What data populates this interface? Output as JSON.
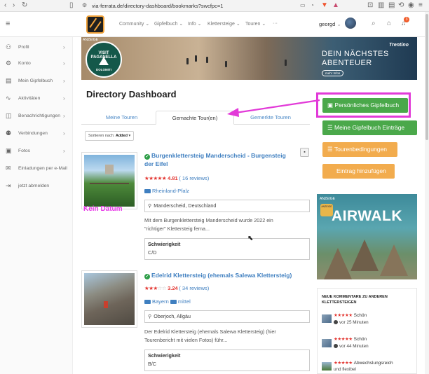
{
  "browser": {
    "url": "via-ferrata.de/directory-dashboard/bookmarks?swcfpc=1"
  },
  "header": {
    "nav": [
      "Community",
      "Gipfelbuch",
      "Info",
      "Klettersteige",
      "Touren",
      "···"
    ],
    "username": "georgd",
    "notification_count": "3"
  },
  "sidebar": {
    "items": [
      {
        "label": "Profil",
        "icon": "user-icon"
      },
      {
        "label": "Konto",
        "icon": "gear-icon"
      },
      {
        "label": "Mein Gipfelbuch",
        "icon": "list-icon"
      },
      {
        "label": "Aktivitäten",
        "icon": "activity-icon"
      },
      {
        "label": "Benachrichtigungen",
        "icon": "bell-icon"
      },
      {
        "label": "Verbindungen",
        "icon": "users-icon"
      },
      {
        "label": "Fotos",
        "icon": "image-icon"
      },
      {
        "label": "Einladungen per e-Mail",
        "icon": "mail-icon"
      },
      {
        "label": "jetzt abmelden",
        "icon": "logout-icon"
      }
    ]
  },
  "banner": {
    "ad_label": "ANZEIGE",
    "badge_line1": "VISIT PAGANELLA",
    "badge_line2": "DOLOMITI",
    "headline1": "DEIN NÄCHSTES",
    "headline2": "ABENTEUER",
    "more": "mehr Infos",
    "brand": "Trentino"
  },
  "page": {
    "title": "Directory Dashboard",
    "tabs": [
      "Meine Touren",
      "Gemachte Tour(en)",
      "Gemerkte Touren"
    ],
    "sort_prefix": "Sortieren nach:",
    "sort_value": "Added",
    "annotation": "Kein Datum"
  },
  "tours": [
    {
      "title_l1": "Burgenklettersteig Manderscheid - Burgensteig",
      "title_l2": "der Eifel",
      "stars": 5,
      "rating": "4.81",
      "reviews": "( 16 reviews)",
      "regions": [
        "Rheinland-Pfalz"
      ],
      "location": "Manderscheid, Deutschland",
      "desc_l1": "Mit dem Burgenklettersteig Manderscheid wurde 2022 ein",
      "desc_l2": "\"richtiger\" Klettersteig ferna...",
      "difficulty_label": "Schwierigkeit",
      "difficulty": "C/D"
    },
    {
      "title_l1": "Edelrid Klettersteig (ehemals Salewa Klettersteig)",
      "stars": 3,
      "rating": "3.24",
      "reviews": "( 34 reviews)",
      "regions": [
        "Bayern",
        "mittel"
      ],
      "location": "Oberjoch, Allgäu",
      "desc_l1": "Der Edelrid Klettersteig (ehemals Salewa Klettersteig) (hier",
      "desc_l2": "Tourenbericht mit vielen Fotos) führ...",
      "difficulty_label": "Schwierigkeit",
      "difficulty": "B/C"
    }
  ],
  "actions": {
    "personal": "Persönliches Gipfelbuch",
    "my_entries": "Meine Gipfelbuch Einträge",
    "conditions": "Tourenbedingungen",
    "add_entry": "Eintrag hinzufügen"
  },
  "ad2": {
    "label": "ANZEIGE",
    "logo": "ANZEIGE",
    "text": "AIRWALK"
  },
  "comments": {
    "title": "NEUE KOMMENTARE ZU ANDEREN KLETTERSTEIGEN",
    "items": [
      {
        "text": "Schön",
        "time": "vor 25 Minuten"
      },
      {
        "text": "Schön",
        "time": "vor 44 Minuten"
      },
      {
        "text": "Abwechslungsreich",
        "text2": "und flexibel"
      }
    ]
  },
  "colors": {
    "accent_blue": "#3f7fc0",
    "green": "#4aa84a",
    "orange": "#f2ac4e",
    "highlight": "#e23ad8",
    "star_red": "#e3342f"
  }
}
